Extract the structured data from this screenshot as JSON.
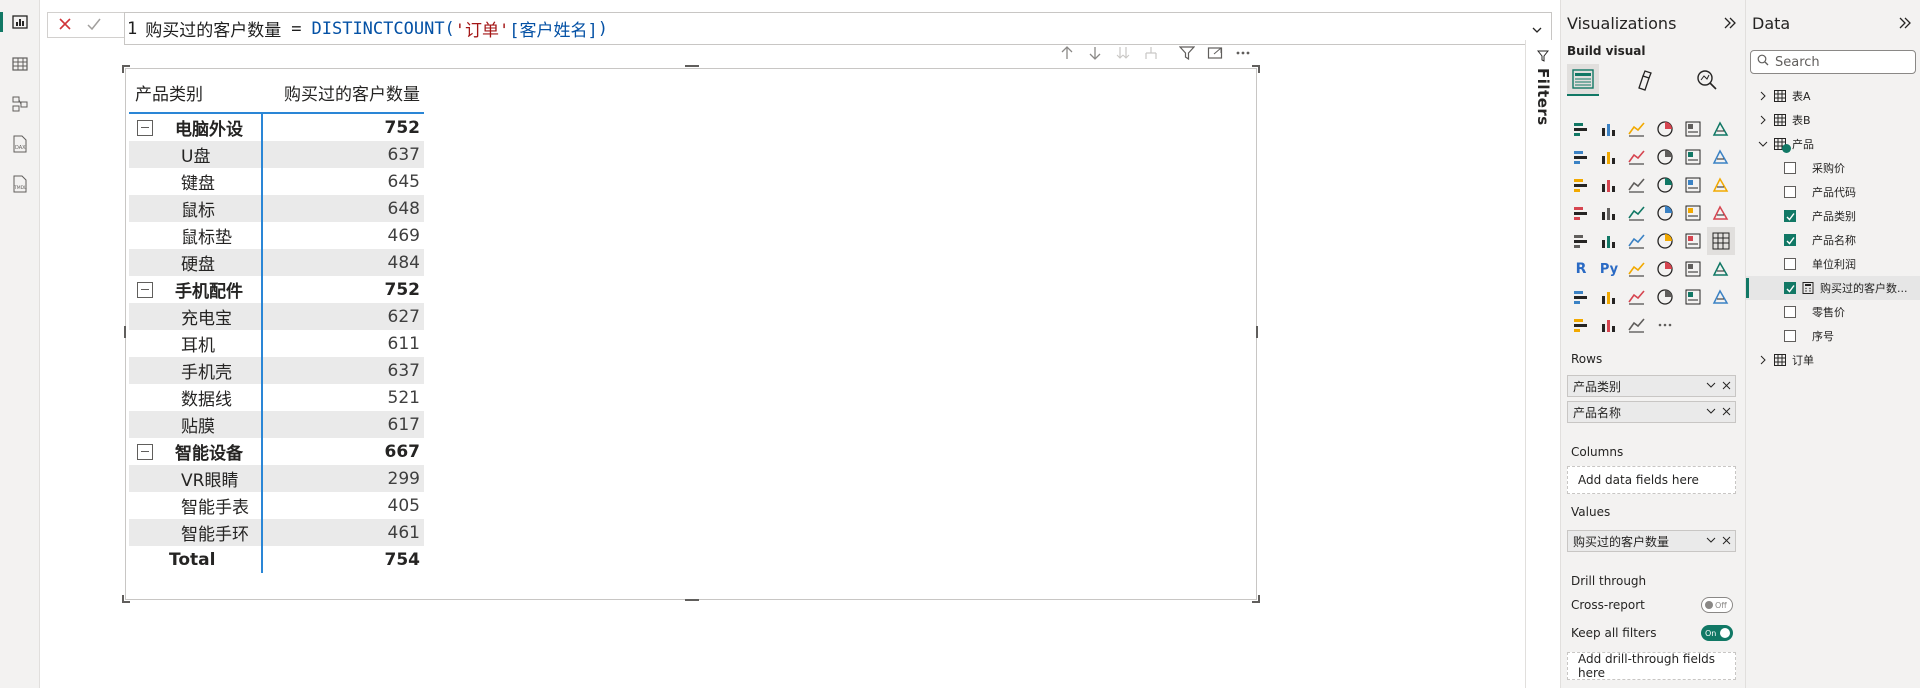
{
  "formula": {
    "line_number": "1",
    "measure_name": "购买过的客户数量",
    "operator": "=",
    "function": "DISTINCTCOUNT(",
    "arg_table": "'订单'",
    "arg_column": "[客户姓名]",
    "close": ")"
  },
  "canvas": {
    "filters_label": "Filters"
  },
  "matrix": {
    "headers": [
      "产品类别",
      "购买过的客户数量"
    ],
    "rows": [
      {
        "type": "cat",
        "label": "电脑外设",
        "value": "752"
      },
      {
        "type": "child",
        "label": "U盘",
        "value": "637"
      },
      {
        "type": "child",
        "label": "键盘",
        "value": "645"
      },
      {
        "type": "child",
        "label": "鼠标",
        "value": "648"
      },
      {
        "type": "child",
        "label": "鼠标垫",
        "value": "469"
      },
      {
        "type": "child",
        "label": "硬盘",
        "value": "484"
      },
      {
        "type": "cat",
        "label": "手机配件",
        "value": "752"
      },
      {
        "type": "child",
        "label": "充电宝",
        "value": "627"
      },
      {
        "type": "child",
        "label": "耳机",
        "value": "611"
      },
      {
        "type": "child",
        "label": "手机壳",
        "value": "637"
      },
      {
        "type": "child",
        "label": "数据线",
        "value": "521"
      },
      {
        "type": "child",
        "label": "贴膜",
        "value": "617"
      },
      {
        "type": "cat",
        "label": "智能设备",
        "value": "667"
      },
      {
        "type": "child",
        "label": "VR眼睛",
        "value": "299"
      },
      {
        "type": "child",
        "label": "智能手表",
        "value": "405"
      },
      {
        "type": "child",
        "label": "智能手环",
        "value": "461"
      },
      {
        "type": "total",
        "label": "Total",
        "value": "754"
      }
    ]
  },
  "viz_pane": {
    "title": "Visualizations",
    "build_visual": "Build visual",
    "rows_label": "Rows",
    "rows_fields": [
      "产品类别",
      "产品名称"
    ],
    "columns_label": "Columns",
    "columns_placeholder": "Add data fields here",
    "values_label": "Values",
    "values_fields": [
      "购买过的客户数量"
    ],
    "drill_label": "Drill through",
    "cross_report_label": "Cross-report",
    "cross_report_state": "Off",
    "keep_filters_label": "Keep all filters",
    "keep_filters_state": "On",
    "drill_placeholder": "Add drill-through fields here",
    "r_label": "R",
    "py_label": "Py"
  },
  "data_pane": {
    "title": "Data",
    "search_placeholder": "Search",
    "tables": [
      {
        "name": "表A",
        "expanded": false
      },
      {
        "name": "表B",
        "expanded": false
      },
      {
        "name": "产品",
        "expanded": true,
        "fields": [
          {
            "name": "采购价",
            "checked": false,
            "calc": false
          },
          {
            "name": "产品代码",
            "checked": false,
            "calc": false
          },
          {
            "name": "产品类别",
            "checked": true,
            "calc": false
          },
          {
            "name": "产品名称",
            "checked": true,
            "calc": false
          },
          {
            "name": "单位利润",
            "checked": false,
            "calc": false
          },
          {
            "name": "购买过的客户数...",
            "checked": true,
            "calc": true,
            "selected": true
          },
          {
            "name": "零售价",
            "checked": false,
            "calc": false
          },
          {
            "name": "序号",
            "checked": false,
            "calc": false
          }
        ]
      },
      {
        "name": "订单",
        "expanded": false
      }
    ]
  },
  "colors": {
    "accent": "#117865",
    "matrix_border": "#2a86d6",
    "alt_row": "#eaeaea"
  }
}
